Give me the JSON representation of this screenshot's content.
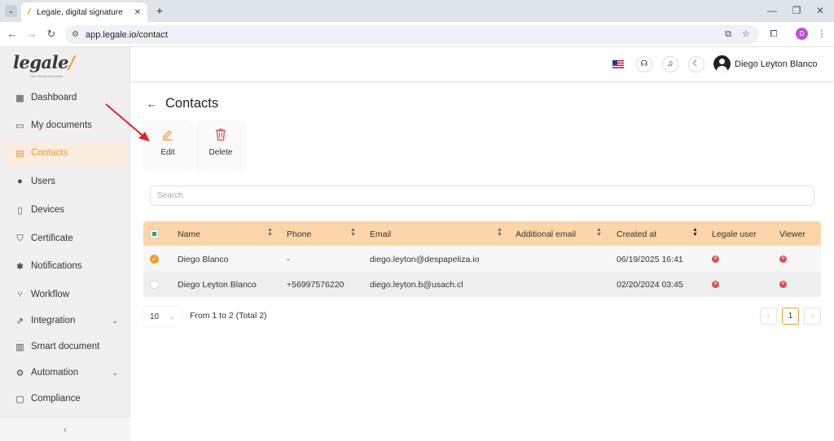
{
  "browser": {
    "tab_title": "Legale, digital signature",
    "tab_close": "✕",
    "new_tab": "+",
    "url": "app.legale.io/contact"
  },
  "app": {
    "logo_text": "legale",
    "logo_tagline": "Fast, secure and smart",
    "user_name": "Diego Leyton Blanco",
    "profile_initial": "D"
  },
  "sidebar": {
    "items": [
      {
        "label": "Dashboard",
        "icon": "dashboard-icon"
      },
      {
        "label": "My documents",
        "icon": "folder-icon"
      },
      {
        "label": "Contacts",
        "icon": "contacts-icon",
        "active": true
      },
      {
        "label": "Users",
        "icon": "user-icon"
      },
      {
        "label": "Devices",
        "icon": "device-icon"
      },
      {
        "label": "Certificate",
        "icon": "shield-icon"
      },
      {
        "label": "Notifications",
        "icon": "bell-icon"
      },
      {
        "label": "Workflow",
        "icon": "workflow-icon"
      },
      {
        "label": "Integration",
        "icon": "integration-icon",
        "expandable": true
      },
      {
        "label": "Smart document",
        "icon": "smart-document-icon"
      },
      {
        "label": "Automation",
        "icon": "gear-icon",
        "expandable": true
      },
      {
        "label": "Compliance",
        "icon": "chat-icon"
      }
    ],
    "collapse_label": "‹"
  },
  "page": {
    "title": "Contacts",
    "actions": {
      "edit": "Edit",
      "delete": "Delete"
    },
    "search_placeholder": "Search"
  },
  "table": {
    "columns": [
      "Name",
      "Phone",
      "Email",
      "Additional email",
      "Created at",
      "Legale user",
      "Viewer"
    ],
    "rows": [
      {
        "selected": true,
        "name": "Diego Blanco",
        "phone": "-",
        "email": "diego.leyton@despapeliza.io",
        "additional_email": "",
        "created_at": "06/19/2025 16:41",
        "legale_user": false,
        "viewer": false
      },
      {
        "selected": false,
        "name": "Diego Leyton Blanco",
        "phone": "+56997576220",
        "email": "diego.leyton.b@usach.cl",
        "additional_email": "",
        "created_at": "02/20/2024 03:45",
        "legale_user": false,
        "viewer": false
      }
    ]
  },
  "pagination": {
    "page_size": "10",
    "range_text": "From 1 to 2 (Total 2)",
    "prev": "‹",
    "current_page": "1",
    "next": "›"
  },
  "colors": {
    "accent": "#f39a2b",
    "table_header": "#fcd6a8",
    "active_nav_bg": "#fbeee0",
    "error_badge": "#e34b4b",
    "annotation_arrow": "#e32222"
  }
}
